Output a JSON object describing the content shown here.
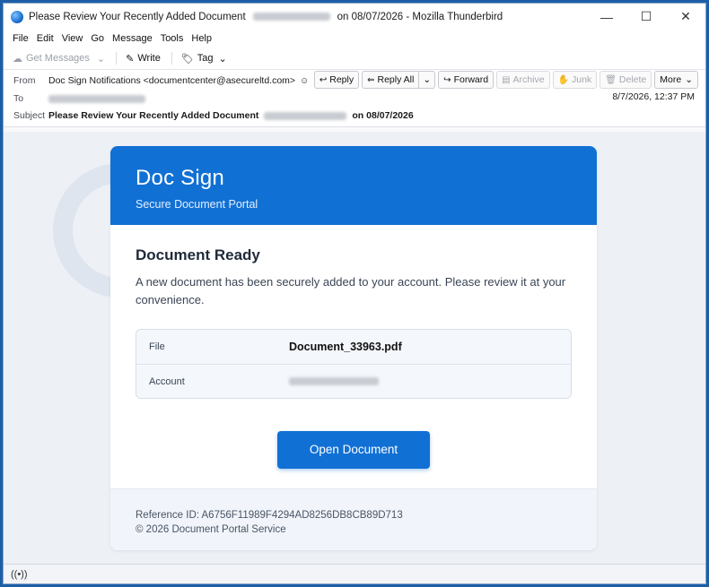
{
  "window": {
    "title_prefix": "Please Review Your Recently Added Document",
    "title_suffix": "on 08/07/2026 - Mozilla Thunderbird",
    "minimize": "—",
    "maximize": "☐",
    "close": "✕"
  },
  "menu": [
    "File",
    "Edit",
    "View",
    "Go",
    "Message",
    "Tools",
    "Help"
  ],
  "toolbar": {
    "get_messages": "Get Messages",
    "write": "Write",
    "tag": "Tag"
  },
  "header": {
    "from_label": "From",
    "from_value": "Doc Sign Notifications <documentcenter@asecureltd.com>",
    "to_label": "To",
    "subject_label": "Subject",
    "subject_prefix": "Please Review Your Recently Added Document",
    "subject_suffix": "on 08/07/2026",
    "date": "8/7/2026, 12:37 PM",
    "actions": {
      "reply": "Reply",
      "reply_all": "Reply All",
      "forward": "Forward",
      "archive": "Archive",
      "junk": "Junk",
      "delete": "Delete",
      "more": "More"
    }
  },
  "email": {
    "brand": "Doc Sign",
    "brand_sub": "Secure Document Portal",
    "heading": "Document Ready",
    "lead": "A new document has been securely added to your account. Please review it at your convenience.",
    "file_label": "File",
    "file_value": "Document_33963.pdf",
    "account_label": "Account",
    "cta": "Open Document",
    "reference": "Reference ID: A6756F11989F4294AD8256DB8CB89D713",
    "copyright": "© 2026 Document Portal Service"
  },
  "status": {
    "icon": "((•))"
  },
  "icons": {
    "app": "thunderbird-icon",
    "accent": "#1170d4"
  }
}
